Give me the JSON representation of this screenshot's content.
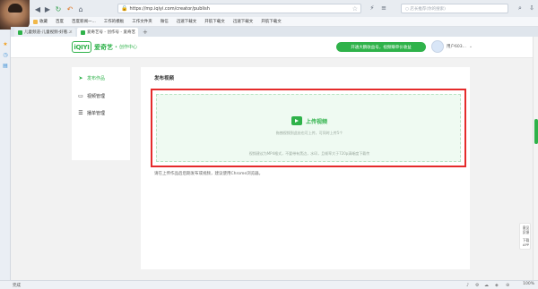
{
  "browser": {
    "address_url": "https://mp.iqiyi.com/creator/publish",
    "search_placeholder": "○ 店长推荐(你的搜索)",
    "bookmarks": [
      "收藏",
      "百度",
      "百度新闻一...",
      "工作的模板",
      "工作文件夹",
      "微信",
      "迅速下载文",
      "开航下载文",
      "迅速下载文",
      "开航下载文"
    ],
    "tabs": [
      {
        "label": "儿童频道-儿童视频-好看...",
        "active": false
      },
      {
        "label": "爱奇艺号 - 创作号 - 爱奇艺",
        "active": true
      }
    ],
    "status_text": "完成",
    "zoom": "100%"
  },
  "site": {
    "logo_text": "iQIYI",
    "brand_name": "爱奇艺",
    "brand_dot": "•",
    "brand_sub": "创作中心",
    "promo_button": "开通大鹏收益号，视频赚单价收益",
    "user_name": "用户603..."
  },
  "sidebar": {
    "items": [
      {
        "label": "发布作品",
        "icon": "send-icon",
        "active": true
      },
      {
        "label": "视频管理",
        "icon": "document-icon",
        "active": false
      },
      {
        "label": "播单管理",
        "icon": "list-icon",
        "active": false
      }
    ]
  },
  "main": {
    "title": "发布视频",
    "upload_label": "上传视频",
    "upload_hint": "拖拽视频到此处也可上传，可同时上传5个",
    "upload_rule": "视频建议为MP4格式，不要带有黑边，水印，且帧率大于720p清晰度下载传",
    "browser_tip": "请在上传作品后后期发布或视频，建议使用Chrome浏览器。"
  },
  "float_panel": {
    "items": [
      "意见",
      "反馈",
      "下载",
      "APP"
    ]
  },
  "colors": {
    "brand_green": "#2fb24a",
    "highlight_red": "#e52b2b"
  }
}
